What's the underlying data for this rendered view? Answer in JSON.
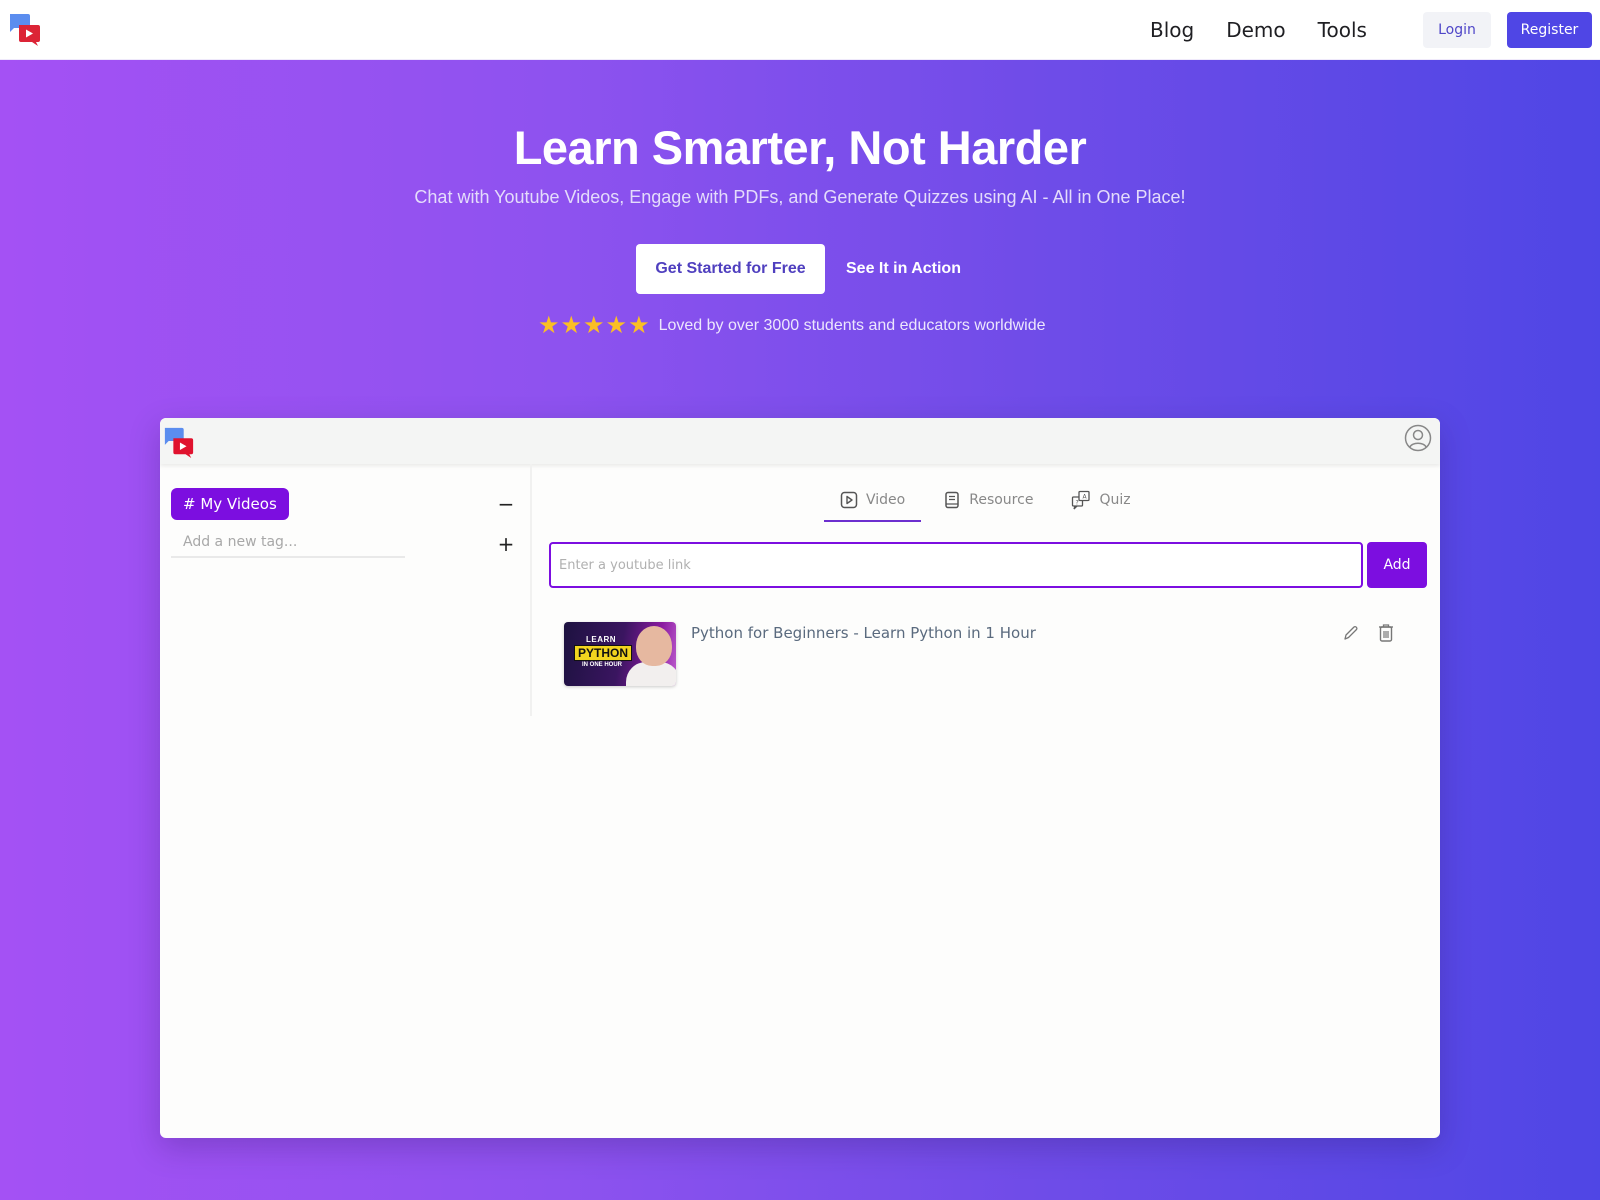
{
  "nav": {
    "logo": "chat-video-logo",
    "links": [
      "Blog",
      "Demo",
      "Tools"
    ],
    "login_label": "Login",
    "register_label": "Register"
  },
  "hero": {
    "title": "Learn Smarter, Not Harder",
    "subtitle": "Chat with Youtube Videos, Engage with PDFs, and Generate Quizzes using AI - All in One Place!",
    "primary_cta": "Get Started for Free",
    "secondary_cta": "See It in Action",
    "rating": {
      "stars": 5,
      "max": 5,
      "star_glyph": "★"
    },
    "rating_text": "Loved by over 3000 students and educators worldwide"
  },
  "colors": {
    "brand": "#4f46e5",
    "accent_purple": "#7c0ee0",
    "gradient_start": "#a451f4",
    "gradient_end": "#4f46e5",
    "star": "#fbbf24"
  },
  "app": {
    "sidebar": {
      "tag_label": "# My Videos",
      "collapse_symbol": "−",
      "add_symbol": "+",
      "tag_input_placeholder": "Add a new tag..."
    },
    "tabs": [
      {
        "label": "Video",
        "icon": "video-play-icon",
        "active": true
      },
      {
        "label": "Resource",
        "icon": "book-icon",
        "active": false
      },
      {
        "label": "Quiz",
        "icon": "quiz-icon",
        "active": false
      }
    ],
    "link_input_placeholder": "Enter a youtube link",
    "add_label": "Add",
    "videos": [
      {
        "title": "Python for Beginners - Learn Python in 1 Hour",
        "thumbnail": {
          "line1": "LEARN",
          "line2": "PYTHON",
          "line3": "IN ONE HOUR"
        }
      }
    ]
  }
}
